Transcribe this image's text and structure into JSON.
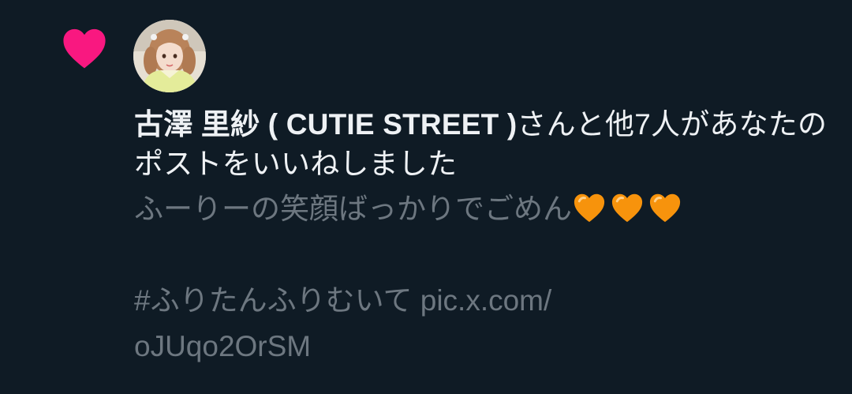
{
  "notification": {
    "type_icon": "heart-icon",
    "type_icon_color": "#f91880",
    "avatar_icon": "user-avatar",
    "user_name": "古澤 里紗 ( CUTIE STREET )",
    "action_text": "さんと他7人があなたのポストをいいねしました",
    "post": {
      "line1": "ふーりーの笑顔ばっかりでごめん",
      "emoji_icon": "orange-heart-icon",
      "emoji_color": "#f7930c",
      "emoji_count": 3,
      "blank": "",
      "line3": "#ふりたんふりむいて pic.x.com/",
      "line4": "oJUqo2OrSM"
    }
  }
}
